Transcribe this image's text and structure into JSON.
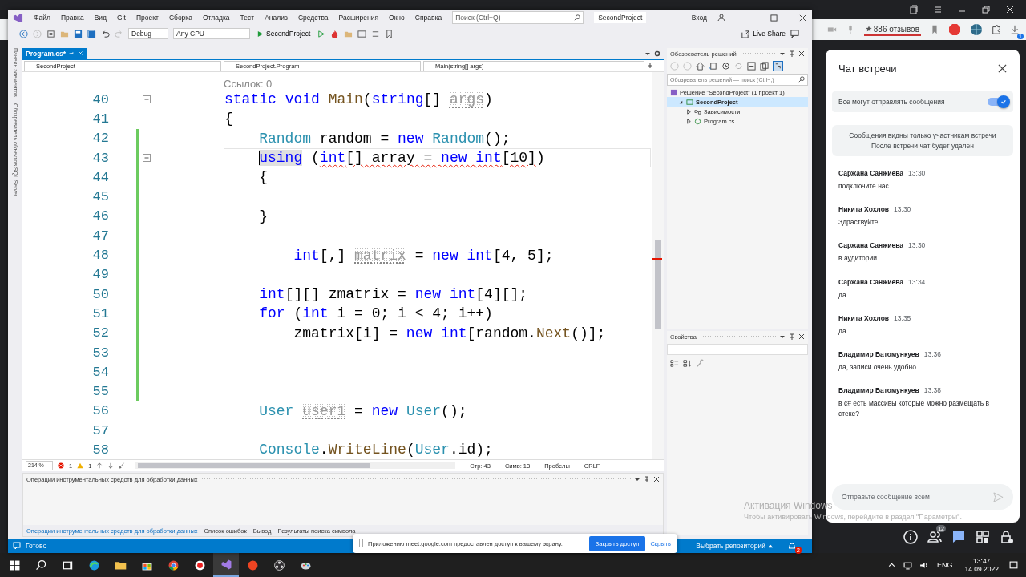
{
  "browser": {
    "rating": "886 отзывов",
    "download_badge": "1"
  },
  "vs": {
    "menu": [
      "Файл",
      "Правка",
      "Вид",
      "Git",
      "Проект",
      "Сборка",
      "Отладка",
      "Тест",
      "Анализ",
      "Средства",
      "Расширения",
      "Окно",
      "Справка"
    ],
    "search_placeholder": "Поиск (Ctrl+Q)",
    "solution_badge": "SecondProject",
    "sign_in": "Вход",
    "toolbar": {
      "configuration": "Debug",
      "platform": "Any CPU",
      "start": "SecondProject",
      "live_share": "Live Share"
    },
    "side_tabs": [
      "Панель элементов",
      "Обозреватель объектов SQL Server"
    ],
    "editor": {
      "tab": {
        "label": "Program.cs*",
        "selected": true
      },
      "nav": [
        "SecondProject",
        "SecondProject.Program",
        "Main(string[] args)"
      ],
      "codelens": "Ссылок: 0",
      "lines": [
        {
          "number": "40",
          "current": false,
          "fold": true,
          "changed": false,
          "tokens": [
            {
              "text": "static ",
              "kind": "kw"
            },
            {
              "text": "void ",
              "kind": "kw"
            },
            {
              "text": "Main",
              "kind": "method"
            },
            {
              "text": "(",
              "kind": "plain"
            },
            {
              "text": "string",
              "kind": "kw"
            },
            {
              "text": "[] ",
              "kind": "plain"
            },
            {
              "text": "args",
              "kind": "unused"
            },
            {
              "text": ")",
              "kind": "plain"
            }
          ]
        },
        {
          "number": "41",
          "current": false,
          "fold": false,
          "changed": false,
          "tokens": [
            {
              "text": "{",
              "kind": "plain"
            }
          ]
        },
        {
          "number": "42",
          "current": false,
          "fold": false,
          "changed": true,
          "tokens": [
            {
              "text": "    Random",
              "kind": "type"
            },
            {
              "text": " random = ",
              "kind": "plain"
            },
            {
              "text": "new ",
              "kind": "kw"
            },
            {
              "text": "Random",
              "kind": "type"
            },
            {
              "text": "();",
              "kind": "plain"
            }
          ]
        },
        {
          "number": "43",
          "current": true,
          "fold": true,
          "changed": true,
          "tokens": [
            {
              "text": "    using",
              "kind": "kw",
              "squiggle": false,
              "highlighted": true
            },
            {
              "text": " (",
              "kind": "plain",
              "squiggle": false,
              "highlighted": false
            },
            {
              "text": "int",
              "kind": "kw",
              "squiggle": true,
              "highlighted": false
            },
            {
              "text": "[] array = ",
              "kind": "plain",
              "squiggle": true,
              "highlighted": false
            },
            {
              "text": "new ",
              "kind": "kw",
              "squiggle": true,
              "highlighted": false
            },
            {
              "text": "int",
              "kind": "kw",
              "squiggle": true,
              "highlighted": false
            },
            {
              "text": "[10]",
              "kind": "plain",
              "squiggle": true,
              "highlighted": false
            },
            {
              "text": ")",
              "kind": "plain",
              "squiggle": false,
              "highlighted": false
            }
          ]
        },
        {
          "number": "44",
          "current": false,
          "fold": false,
          "changed": true,
          "tokens": [
            {
              "text": "    {",
              "kind": "plain"
            }
          ]
        },
        {
          "number": "45",
          "current": false,
          "fold": false,
          "changed": true
        },
        {
          "number": "46",
          "current": false,
          "fold": false,
          "changed": true,
          "tokens": [
            {
              "text": "    }",
              "kind": "plain"
            }
          ]
        },
        {
          "number": "47",
          "current": false,
          "fold": false,
          "changed": true
        },
        {
          "number": "48",
          "current": false,
          "fold": false,
          "changed": true,
          "tokens": [
            {
              "text": "        int",
              "kind": "kw"
            },
            {
              "text": "[,] ",
              "kind": "plain"
            },
            {
              "text": "matrix",
              "kind": "unused"
            },
            {
              "text": " = ",
              "kind": "plain"
            },
            {
              "text": "new ",
              "kind": "kw"
            },
            {
              "text": "int",
              "kind": "kw"
            },
            {
              "text": "[4, 5];",
              "kind": "plain"
            }
          ]
        },
        {
          "number": "49",
          "current": false,
          "fold": false,
          "changed": true
        },
        {
          "number": "50",
          "current": false,
          "fold": false,
          "changed": true,
          "tokens": [
            {
              "text": "    int",
              "kind": "kw"
            },
            {
              "text": "[][] zmatrix = ",
              "kind": "plain"
            },
            {
              "text": "new ",
              "kind": "kw"
            },
            {
              "text": "int",
              "kind": "kw"
            },
            {
              "text": "[4][];",
              "kind": "plain"
            }
          ]
        },
        {
          "number": "51",
          "current": false,
          "fold": false,
          "changed": true,
          "tokens": [
            {
              "text": "    for",
              "kind": "kw"
            },
            {
              "text": " (",
              "kind": "plain"
            },
            {
              "text": "int",
              "kind": "kw"
            },
            {
              "text": " i = 0; i < 4; i++)",
              "kind": "plain"
            }
          ]
        },
        {
          "number": "52",
          "current": false,
          "fold": false,
          "changed": true,
          "tokens": [
            {
              "text": "        zmatrix[i] = ",
              "kind": "plain"
            },
            {
              "text": "new ",
              "kind": "kw"
            },
            {
              "text": "int",
              "kind": "kw"
            },
            {
              "text": "[random.",
              "kind": "plain"
            },
            {
              "text": "Next",
              "kind": "method"
            },
            {
              "text": "()];",
              "kind": "plain"
            }
          ]
        },
        {
          "number": "53",
          "current": false,
          "fold": false,
          "changed": true
        },
        {
          "number": "54",
          "current": false,
          "fold": false,
          "changed": true
        },
        {
          "number": "55",
          "current": false,
          "fold": false,
          "changed": true
        },
        {
          "number": "56",
          "current": false,
          "fold": false,
          "changed": false,
          "tokens": [
            {
              "text": "    User ",
              "kind": "type"
            },
            {
              "text": "user1",
              "kind": "unused"
            },
            {
              "text": " = ",
              "kind": "plain"
            },
            {
              "text": "new ",
              "kind": "kw"
            },
            {
              "text": "User",
              "kind": "type"
            },
            {
              "text": "();",
              "kind": "plain"
            }
          ]
        },
        {
          "number": "57",
          "current": false,
          "fold": false,
          "changed": false
        },
        {
          "number": "58",
          "current": false,
          "fold": false,
          "changed": false,
          "tokens": [
            {
              "text": "    Console",
              "kind": "type"
            },
            {
              "text": ".",
              "kind": "plain"
            },
            {
              "text": "WriteLine",
              "kind": "method"
            },
            {
              "text": "(",
              "kind": "plain"
            },
            {
              "text": "User",
              "kind": "type"
            },
            {
              "text": ".id);",
              "kind": "plain"
            }
          ]
        }
      ],
      "status": {
        "zoom": "214 %",
        "errors": "1",
        "warnings": "1",
        "line": "Стр: 43",
        "col": "Симв: 13",
        "spaces": "Пробелы",
        "eol": "CRLF"
      }
    },
    "solution_explorer": {
      "title": "Обозреватель решений",
      "search_placeholder": "Обозреватель решений — поиск (Ctrl+;)",
      "tree": [
        {
          "label": "Решение \"SecondProject\" (1 проект 1)",
          "kind": "solution",
          "selected": false,
          "children": [
            {
              "label": "SecondProject",
              "kind": "project",
              "expanded": true,
              "selected": true,
              "children": [
                {
                  "label": "Зависимости",
                  "kind": "deps",
                  "expanded": false,
                  "selected": false
                },
                {
                  "label": "Program.cs",
                  "kind": "csharp",
                  "expanded": false,
                  "selected": false
                }
              ]
            }
          ]
        }
      ]
    },
    "properties": {
      "title": "Свойства"
    },
    "bottom_panel": {
      "title": "Операции инструментальных средств для обработки данных",
      "tabs": [
        {
          "label": "Операции инструментальных средств для обработки данных",
          "selected": true
        },
        {
          "label": "Список ошибок",
          "selected": false
        },
        {
          "label": "Вывод",
          "selected": false
        },
        {
          "label": "Результаты поиска символа",
          "selected": false
        }
      ]
    },
    "status_bar": {
      "ready": "Готово",
      "repo": "Выбрать репозиторий",
      "notifications": "2"
    }
  },
  "share_notice": {
    "text": "Приложению meet.google.com предоставлен доступ к вашему экрану.",
    "stop": "Закрыть доступ",
    "hide": "Скрыть"
  },
  "chat": {
    "title": "Чат встречи",
    "toggle": {
      "label": "Все могут отправлять сообщения",
      "on": true
    },
    "notice": [
      "Сообщения видны только участникам встречи",
      "После встречи чат будет удален"
    ],
    "messages": [
      {
        "author": "Саржана Санжиева",
        "time": "13:30",
        "text": "подключите нас"
      },
      {
        "author": "Никита Хохлов",
        "time": "13:30",
        "text": "Здраствуйте"
      },
      {
        "author": "Саржана Санжиева",
        "time": "13:30",
        "text": "в аудитории"
      },
      {
        "author": "Саржана Санжиева",
        "time": "13:34",
        "text": "да"
      },
      {
        "author": "Никита Хохлов",
        "time": "13:35",
        "text": "да"
      },
      {
        "author": "Владимир Батомункуев",
        "time": "13:36",
        "text": "да, записи очень удобно"
      },
      {
        "author": "Владимир Батомункуев",
        "time": "13:38",
        "text": "в c# есть массивы которые можно размещать в стеке?"
      }
    ],
    "placeholder": "Отправьте сообщение всем"
  },
  "meet_controls": [
    {
      "kind": "info",
      "selected": false
    },
    {
      "kind": "people",
      "selected": false,
      "badge": "12"
    },
    {
      "kind": "chat",
      "selected": true
    },
    {
      "kind": "activities",
      "selected": false
    },
    {
      "kind": "host",
      "selected": false
    }
  ],
  "activation": {
    "title": "Активация Windows",
    "text": "Чтобы активировать Windows, перейдите в раздел \"Параметры\"."
  },
  "taskbar": {
    "apps": [
      {
        "kind": "start",
        "selected": false
      },
      {
        "kind": "search",
        "selected": false
      },
      {
        "kind": "taskview",
        "selected": false
      },
      {
        "kind": "edge",
        "selected": false
      },
      {
        "kind": "files",
        "selected": false
      },
      {
        "kind": "store",
        "selected": false
      },
      {
        "kind": "chrome",
        "selected": false
      },
      {
        "kind": "ybrowser",
        "selected": false
      },
      {
        "kind": "vs",
        "selected": true
      },
      {
        "kind": "yandex",
        "selected": false
      },
      {
        "kind": "obs",
        "selected": false
      },
      {
        "kind": "paint",
        "selected": false
      }
    ],
    "lang": "ENG",
    "time": "13:47",
    "date": "14.09.2022"
  }
}
